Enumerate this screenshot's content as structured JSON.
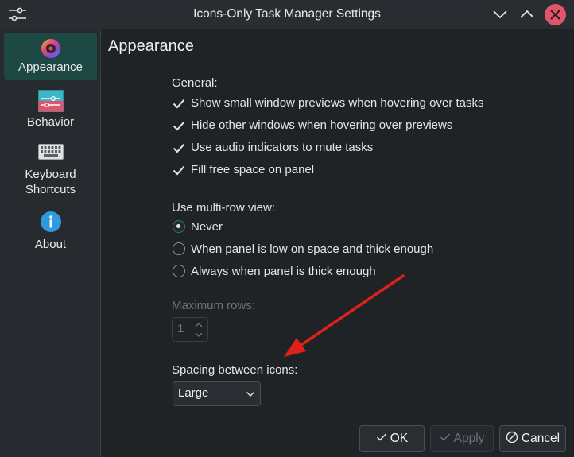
{
  "window": {
    "title": "Icons-Only Task Manager Settings"
  },
  "sidebar": {
    "items": [
      {
        "label": "Appearance",
        "icon": "color-wheel-icon"
      },
      {
        "label": "Behavior",
        "icon": "window-settings-icon"
      },
      {
        "label": "Keyboard\nShortcuts",
        "line1": "Keyboard",
        "line2": "Shortcuts",
        "icon": "keyboard-icon"
      },
      {
        "label": "About",
        "icon": "info-icon"
      }
    ]
  },
  "page": {
    "title": "Appearance",
    "general_label": "General:",
    "checkboxes": [
      {
        "label": "Show small window previews when hovering over tasks",
        "checked": true
      },
      {
        "label": "Hide other windows when hovering over previews",
        "checked": true
      },
      {
        "label": "Use audio indicators to mute tasks",
        "checked": true
      },
      {
        "label": "Fill free space on panel",
        "checked": true
      }
    ],
    "multirow_label": "Use multi-row view:",
    "radios": [
      {
        "label": "Never",
        "checked": true
      },
      {
        "label": "When panel is low on space and thick enough",
        "checked": false
      },
      {
        "label": "Always when panel is thick enough",
        "checked": false
      }
    ],
    "max_rows_label": "Maximum rows:",
    "max_rows_value": "1",
    "spacing_label": "Spacing between icons:",
    "spacing_value": "Large"
  },
  "buttons": {
    "ok": "OK",
    "apply": "Apply",
    "cancel": "Cancel"
  },
  "colors": {
    "accent": "#2a7d73",
    "selected_bg": "#1e4844",
    "annotation_arrow": "#e0201a",
    "close_button": "#e0556b"
  }
}
